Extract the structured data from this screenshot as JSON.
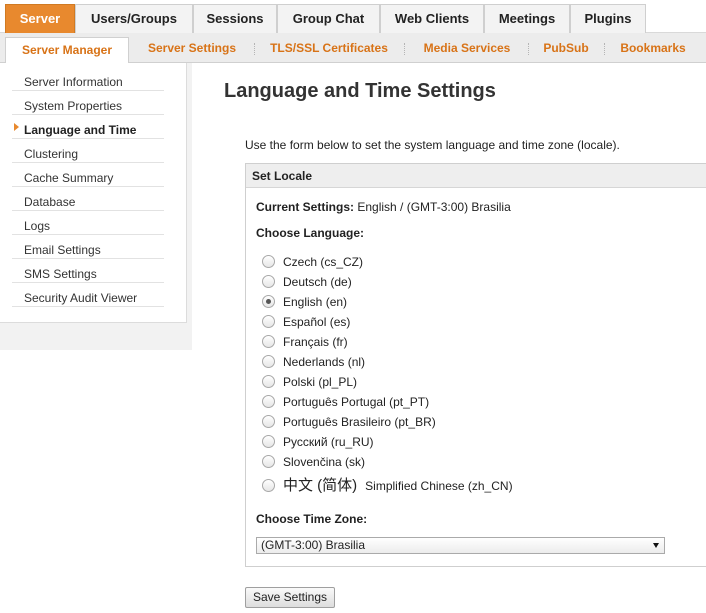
{
  "top_tabs": [
    {
      "label": "Server",
      "active": true
    },
    {
      "label": "Users/Groups"
    },
    {
      "label": "Sessions"
    },
    {
      "label": "Group Chat"
    },
    {
      "label": "Web Clients"
    },
    {
      "label": "Meetings"
    },
    {
      "label": "Plugins"
    }
  ],
  "sub_tabs": [
    {
      "label": "Server Manager",
      "active": true
    },
    {
      "label": "Server Settings"
    },
    {
      "label": "TLS/SSL Certificates"
    },
    {
      "label": "Media Services"
    },
    {
      "label": "PubSub"
    },
    {
      "label": "Bookmarks"
    }
  ],
  "sidebar": {
    "items": [
      {
        "label": "Server Information"
      },
      {
        "label": "System Properties"
      },
      {
        "label": "Language and Time",
        "active": true
      },
      {
        "label": "Clustering"
      },
      {
        "label": "Cache Summary"
      },
      {
        "label": "Database"
      },
      {
        "label": "Logs"
      },
      {
        "label": "Email Settings"
      },
      {
        "label": "SMS Settings"
      },
      {
        "label": "Security Audit Viewer"
      }
    ]
  },
  "main": {
    "title": "Language and Time Settings",
    "intro": "Use the form below to set the system language and time zone (locale).",
    "panel_title": "Set Locale",
    "current_label": "Current Settings:",
    "current_value": "English / (GMT-3:00) Brasilia",
    "choose_language": "Choose Language:",
    "languages": [
      {
        "label": "Czech (cs_CZ)"
      },
      {
        "label": "Deutsch (de)"
      },
      {
        "label": "English (en)",
        "selected": true
      },
      {
        "label": "Español (es)"
      },
      {
        "label": "Français (fr)"
      },
      {
        "label": "Nederlands (nl)"
      },
      {
        "label": "Polski (pl_PL)"
      },
      {
        "label": "Português Portugal (pt_PT)"
      },
      {
        "label": "Português Brasileiro (pt_BR)"
      },
      {
        "label": "Русский (ru_RU)"
      },
      {
        "label": "Slovenčina (sk)"
      },
      {
        "native": "中文 (简体)",
        "label": "Simplified Chinese (zh_CN)"
      }
    ],
    "choose_timezone": "Choose Time Zone:",
    "timezone_value": "(GMT-3:00) Brasilia",
    "save_label": "Save Settings"
  },
  "colors": {
    "accent": "#e8892e",
    "subtab_text": "#d87317"
  },
  "icons": {
    "sidebar_marker": "caret-right-icon",
    "select_arrow": "triangle-down-icon"
  }
}
